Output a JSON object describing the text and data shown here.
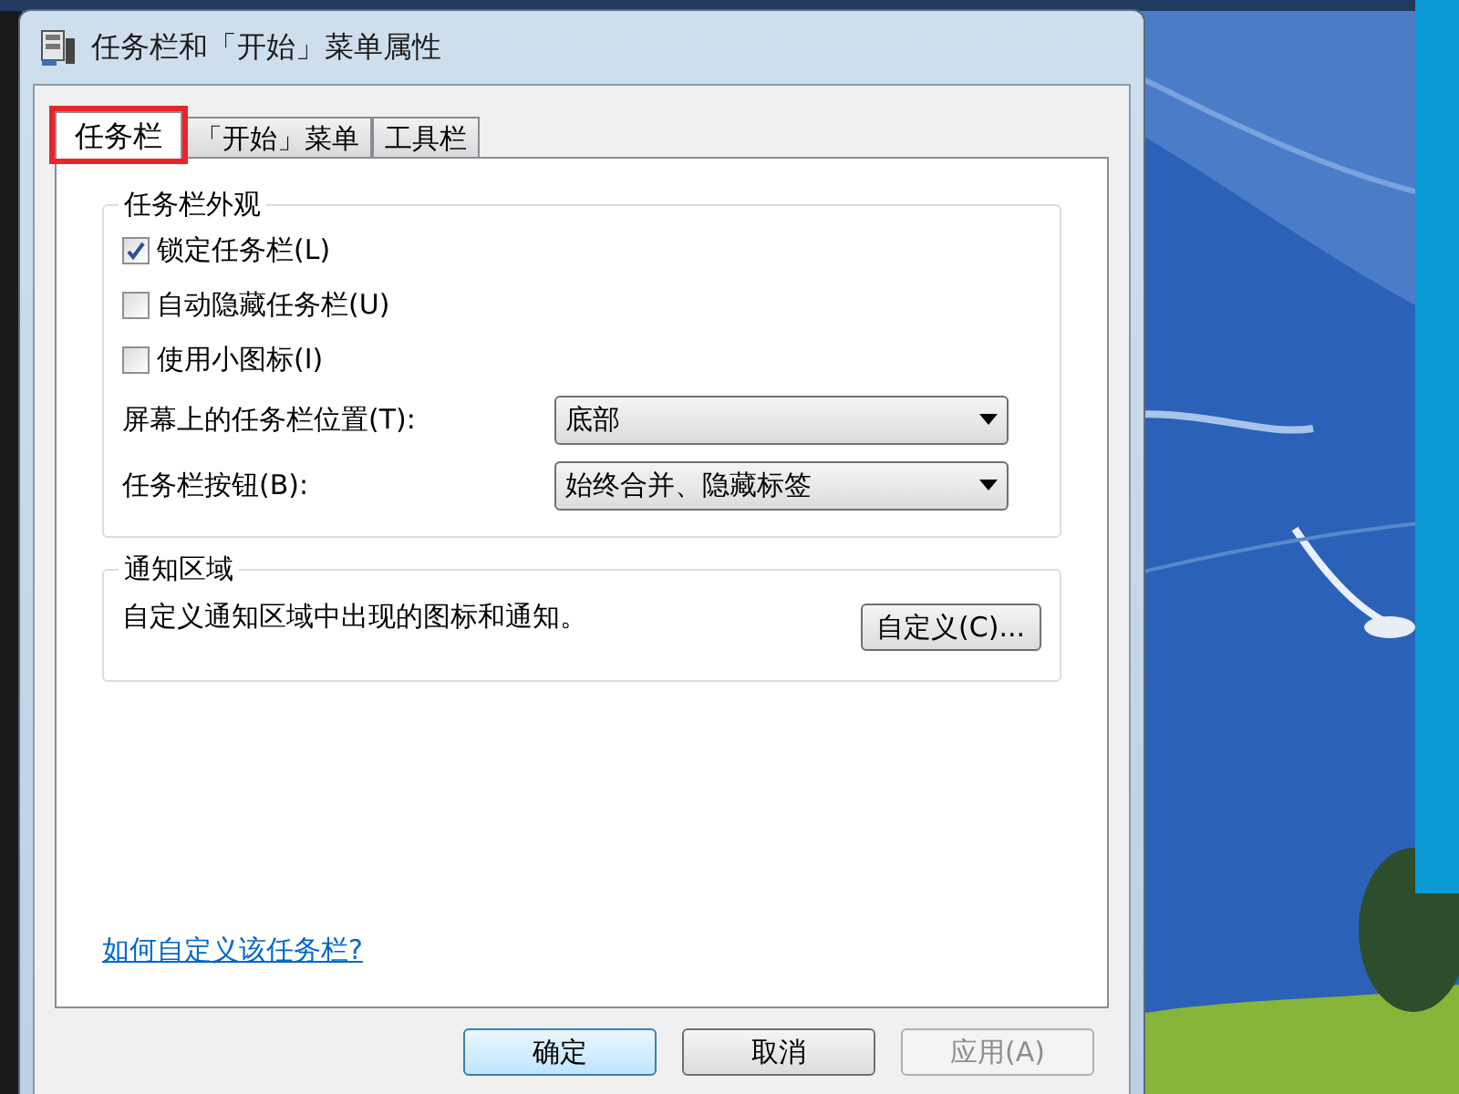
{
  "window": {
    "title": "任务栏和「开始」菜单属性"
  },
  "tabs": [
    {
      "label": "任务栏",
      "selected": true,
      "highlighted": true
    },
    {
      "label": "「开始」菜单",
      "selected": false,
      "highlighted": false
    },
    {
      "label": "工具栏",
      "selected": false,
      "highlighted": false
    }
  ],
  "appearance": {
    "title": "任务栏外观",
    "checkboxes": [
      {
        "label": "锁定任务栏(L)",
        "checked": true
      },
      {
        "label": "自动隐藏任务栏(U)",
        "checked": false
      },
      {
        "label": "使用小图标(I)",
        "checked": false
      }
    ],
    "dropdowns": [
      {
        "label": "屏幕上的任务栏位置(T):",
        "value": "底部"
      },
      {
        "label": "任务栏按钮(B):",
        "value": "始终合并、隐藏标签"
      }
    ]
  },
  "notification": {
    "title": "通知区域",
    "text": "自定义通知区域中出现的图标和通知。",
    "button": "自定义(C)..."
  },
  "link": "如何自定义该任务栏?",
  "buttons": [
    {
      "label": "确定",
      "default": true,
      "disabled": false
    },
    {
      "label": "取消",
      "default": false,
      "disabled": false
    },
    {
      "label": "应用(A)",
      "default": false,
      "disabled": true
    }
  ]
}
